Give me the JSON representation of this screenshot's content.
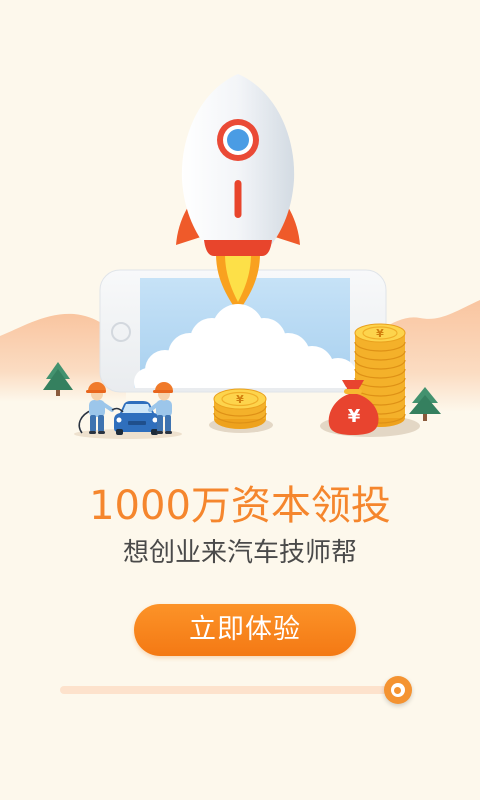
{
  "colors": {
    "background": "#fdf8ec",
    "accent": "#f5862d",
    "button_start": "#fc9328",
    "button_end": "#f47914",
    "button_text": "#ffffff",
    "text_secondary": "#4a4a4a",
    "slider_track": "#fde2cc",
    "slider_knob": "#f49331"
  },
  "illustration": {
    "coin_symbol": "¥",
    "bag_symbol": "¥"
  },
  "headline": "1000万资本领投",
  "subheadline": "想创业来汽车技师帮",
  "cta_button": {
    "label": "立即体验"
  },
  "progress_slider": {
    "value": 0.96
  }
}
